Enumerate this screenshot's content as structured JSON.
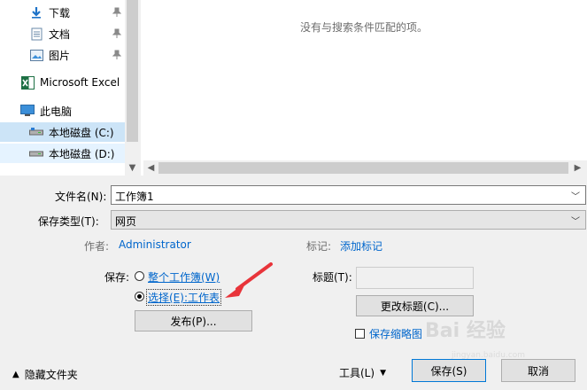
{
  "nav": {
    "items": [
      {
        "label": "下载",
        "icon": "download-arrow-icon",
        "pinned": true
      },
      {
        "label": "文档",
        "icon": "document-icon",
        "pinned": true
      },
      {
        "label": "图片",
        "icon": "picture-icon",
        "pinned": true
      },
      {
        "label": "Microsoft Excel",
        "icon": "excel-icon",
        "pinned": false
      },
      {
        "label": "此电脑",
        "icon": "computer-icon",
        "pinned": false
      },
      {
        "label": "本地磁盘 (C:)",
        "icon": "drive-icon",
        "pinned": false,
        "selected": true
      },
      {
        "label": "本地磁盘 (D:)",
        "icon": "drive-icon",
        "pinned": false,
        "hover": true
      }
    ]
  },
  "filelist": {
    "empty_message": "没有与搜索条件匹配的项。"
  },
  "form": {
    "filename_label": "文件名(N):",
    "filename_value": "工作簿1",
    "filetype_label": "保存类型(T):",
    "filetype_value": "网页",
    "author_label": "作者:",
    "author_value": "Administrator",
    "tags_label": "标记:",
    "tags_value": "添加标记",
    "save_label": "保存:",
    "option_entire": "整个工作簿(W)",
    "option_selection": "选择(E):工作表",
    "selected_option": "selection",
    "publish_button": "发布(P)...",
    "title_label": "标题(T):",
    "title_value": "",
    "change_title_button": "更改标题(C)...",
    "thumbnail_label": "保存缩略图",
    "thumbnail_checked": false
  },
  "footer": {
    "hide_folders": "隐藏文件夹",
    "tools": "工具(L)",
    "save": "保存(S)",
    "cancel": "取消"
  },
  "watermark": {
    "text": "Bai 经验",
    "url": "jingyan.baidu.com"
  },
  "colors": {
    "accent": "#0078d7",
    "link": "#0066cc",
    "selection": "#cce4f7",
    "annotation_arrow": "#e8343a"
  }
}
